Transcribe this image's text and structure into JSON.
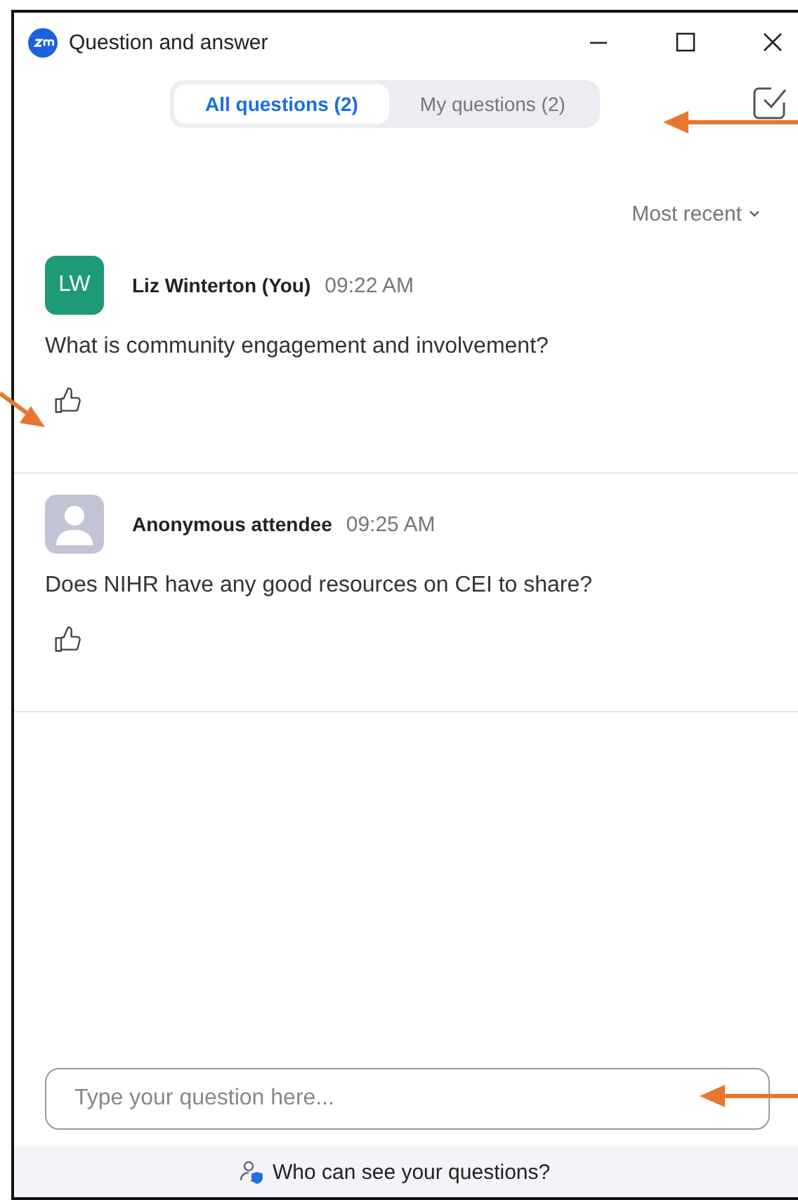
{
  "window": {
    "title": "Question and answer"
  },
  "tabs": [
    {
      "label": "All questions (2)",
      "selected": true
    },
    {
      "label": "My questions (2)",
      "selected": false
    }
  ],
  "sort": {
    "label": "Most recent"
  },
  "questions": [
    {
      "avatar": {
        "kind": "initials",
        "initials": "LW"
      },
      "author": "Liz Winterton (You)",
      "time": "09:22 AM",
      "text": "What is community engagement and involvement?"
    },
    {
      "avatar": {
        "kind": "placeholder"
      },
      "author": "Anonymous attendee",
      "time": "09:25 AM",
      "text": "Does NIHR have any good resources on CEI to share?"
    }
  ],
  "input": {
    "placeholder": "Type your question here..."
  },
  "footer": {
    "label": "Who can see your questions?"
  }
}
